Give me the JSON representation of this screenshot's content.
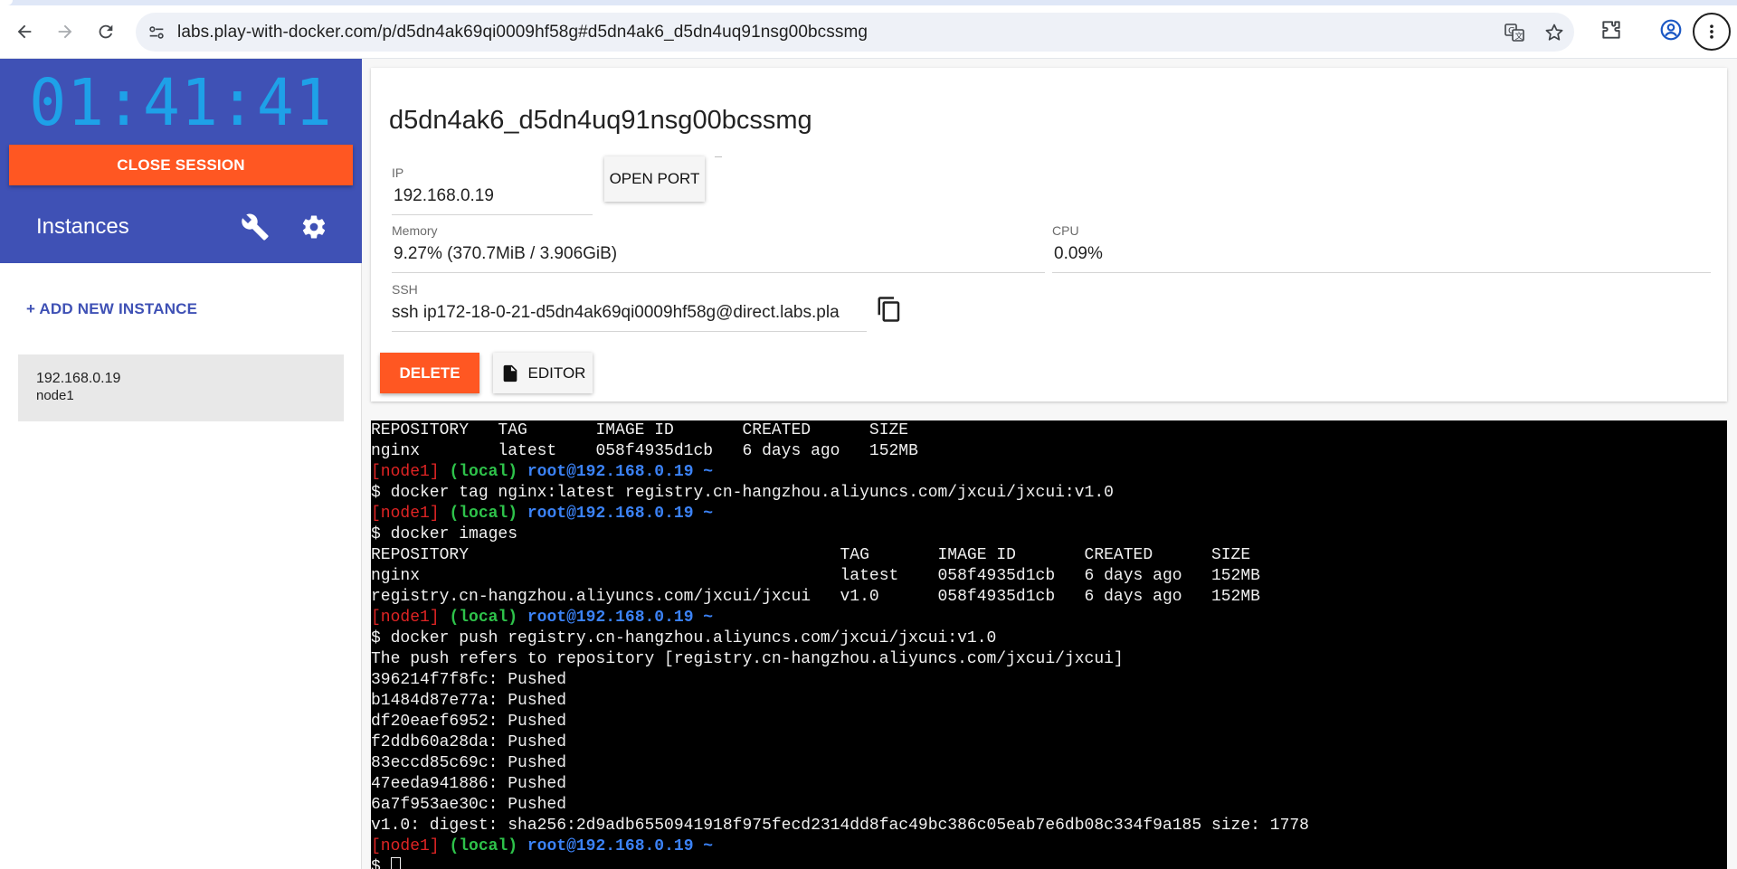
{
  "browser": {
    "url": "labs.play-with-docker.com/p/d5dn4ak69qi0009hf58g#d5dn4ak6_d5dn4uq91nsg00bcssmg"
  },
  "sidebar": {
    "timer": "01:41:41",
    "close_session_label": "CLOSE SESSION",
    "instances_title": "Instances",
    "add_instance_label": "+ ADD NEW INSTANCE",
    "instances": [
      {
        "ip": "192.168.0.19",
        "name": "node1"
      }
    ]
  },
  "details": {
    "title": "d5dn4ak6_d5dn4uq91nsg00bcssmg",
    "ip_label": "IP",
    "ip_value": "192.168.0.19",
    "open_port_label": "OPEN PORT",
    "memory_label": "Memory",
    "memory_value": "9.27% (370.7MiB / 3.906GiB)",
    "cpu_label": "CPU",
    "cpu_value": "0.09%",
    "ssh_label": "SSH",
    "ssh_value": "ssh ip172-18-0-21-d5dn4ak69qi0009hf58g@direct.labs.pla",
    "delete_label": "DELETE",
    "editor_label": "EDITOR"
  },
  "terminal": {
    "prompt": {
      "node": "[node1]",
      "local": "(local)",
      "root": "root@192.168.0.19 ~"
    },
    "lines": [
      "REPOSITORY   TAG       IMAGE ID       CREATED      SIZE",
      "nginx        latest    058f4935d1cb   6 days ago   152MB",
      "$ docker tag nginx:latest registry.cn-hangzhou.aliyuncs.com/jxcui/jxcui:v1.0",
      "$ docker images",
      "REPOSITORY                                      TAG       IMAGE ID       CREATED      SIZE",
      "nginx                                           latest    058f4935d1cb   6 days ago   152MB",
      "registry.cn-hangzhou.aliyuncs.com/jxcui/jxcui   v1.0      058f4935d1cb   6 days ago   152MB",
      "$ docker push registry.cn-hangzhou.aliyuncs.com/jxcui/jxcui:v1.0",
      "The push refers to repository [registry.cn-hangzhou.aliyuncs.com/jxcui/jxcui]",
      "396214f7f8fc: Pushed",
      "b1484d87e77a: Pushed",
      "df20eaef6952: Pushed",
      "f2ddb60a28da: Pushed",
      "83eccd85c69c: Pushed",
      "47eeda941886: Pushed",
      "6a7f953ae30c: Pushed",
      "v1.0: digest: sha256:2d9adb6550941918f975fecd2314dd8fac49bc386c05eab7e6db08c334f9a185 size: 1778",
      "$ "
    ]
  }
}
